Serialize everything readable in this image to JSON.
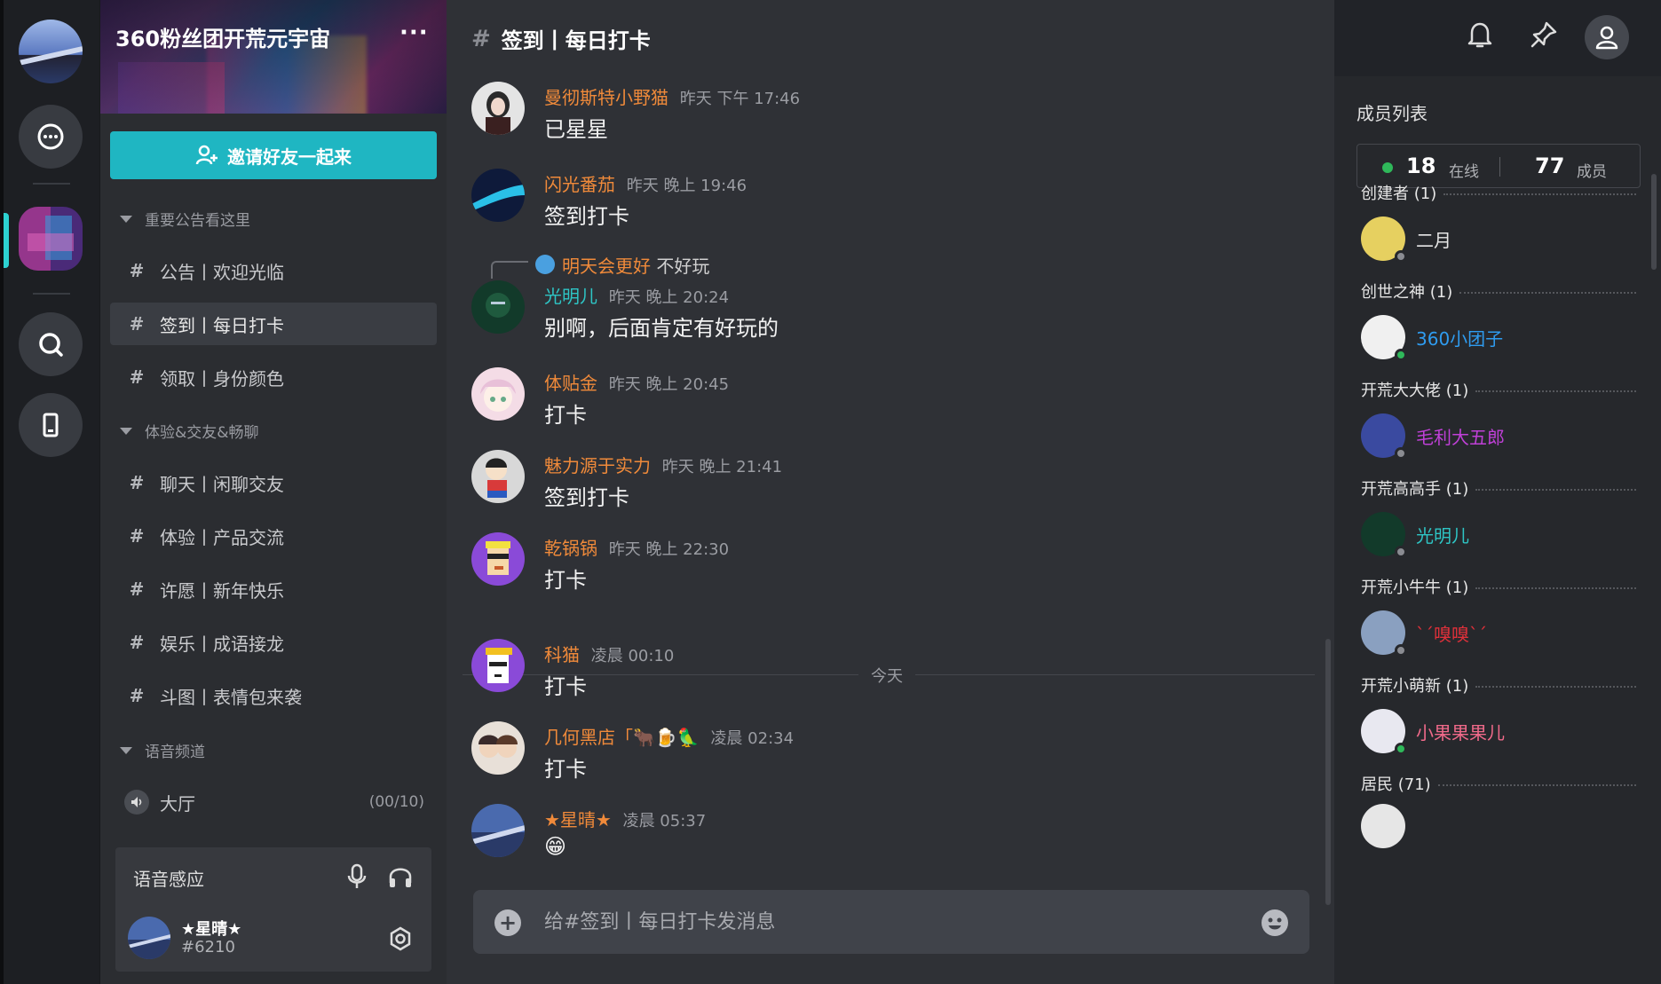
{
  "server": {
    "name": "360粉丝团开荒元宇宙",
    "more": "···",
    "invite_label": "邀请好友一起来"
  },
  "categories": [
    {
      "label": "重要公告看这里"
    },
    {
      "label": "体验&交友&畅聊"
    },
    {
      "label": "语音频道"
    }
  ],
  "channels": [
    {
      "label": "公告丨欢迎光临"
    },
    {
      "label": "签到丨每日打卡"
    },
    {
      "label": "领取丨身份颜色"
    },
    {
      "label": "聊天丨闲聊交友"
    },
    {
      "label": "体验丨产品交流"
    },
    {
      "label": "许愿丨新年快乐"
    },
    {
      "label": "娱乐丨成语接龙"
    },
    {
      "label": "斗图丨表情包来袭"
    }
  ],
  "voice_channel": {
    "label": "大厅",
    "count": "(00/10)"
  },
  "voice_panel": {
    "title": "语音感应",
    "user_name": "★星晴★",
    "user_tag": "#6210"
  },
  "header": {
    "hash": "#",
    "title": "签到丨每日打卡"
  },
  "messages": [
    {
      "name": "曼彻斯特小野猫",
      "time": "昨天 下午 17:46",
      "text": "已星星"
    },
    {
      "name": "闪光番茄",
      "time": "昨天 晚上 19:46",
      "text": "签到打卡"
    },
    {
      "reply_name": "明天会更好",
      "reply_text": "不好玩",
      "name": "光明儿",
      "time": "昨天 晚上 20:24",
      "text": "别啊，后面肯定有好玩的"
    },
    {
      "name": "体贴金",
      "time": "昨天 晚上 20:45",
      "text": "打卡"
    },
    {
      "name": "魅力源于实力",
      "time": "昨天 晚上 21:41",
      "text": "签到打卡"
    },
    {
      "name": "乾锅锅",
      "time": "昨天 晚上 22:30",
      "text": "打卡"
    },
    {
      "name": "科猫",
      "time": "凌晨 00:10",
      "text": "打卡"
    },
    {
      "name": "几何黑店「🐂🍺🦜",
      "time": "凌晨 02:34",
      "text": "打卡"
    },
    {
      "name": "★星晴★",
      "time": "凌晨 05:37",
      "text": "😁"
    }
  ],
  "divider": "今天",
  "composer": {
    "placeholder": "给#签到丨每日打卡发消息"
  },
  "members": {
    "title": "成员列表",
    "online_count": "18",
    "online_label": "在线",
    "member_count": "77",
    "member_label": "成员",
    "roles": [
      {
        "label": "创建者 (1)",
        "member": "二月",
        "color": "#e6e6e6",
        "status": "#8a8c92"
      },
      {
        "label": "创世之神 (1)",
        "member": "360小团子",
        "color": "#2f9cf0",
        "status": "#2fb85a"
      },
      {
        "label": "开荒大大佬 (1)",
        "member": "毛利大五郎",
        "color": "#c040d8",
        "status": "#8a8c92"
      },
      {
        "label": "开荒高高手 (1)",
        "member": "光明儿",
        "color": "#2ec5c5",
        "status": "#8a8c92"
      },
      {
        "label": "开荒小牛牛 (1)",
        "member": "`´嗅嗅`´",
        "color": "#e0303a",
        "status": "#8a8c92"
      },
      {
        "label": "开荒小萌新 (1)",
        "member": "小果果果儿",
        "color": "#f06a8a",
        "status": "#2fb85a"
      },
      {
        "label": "居民 (71)"
      }
    ]
  }
}
